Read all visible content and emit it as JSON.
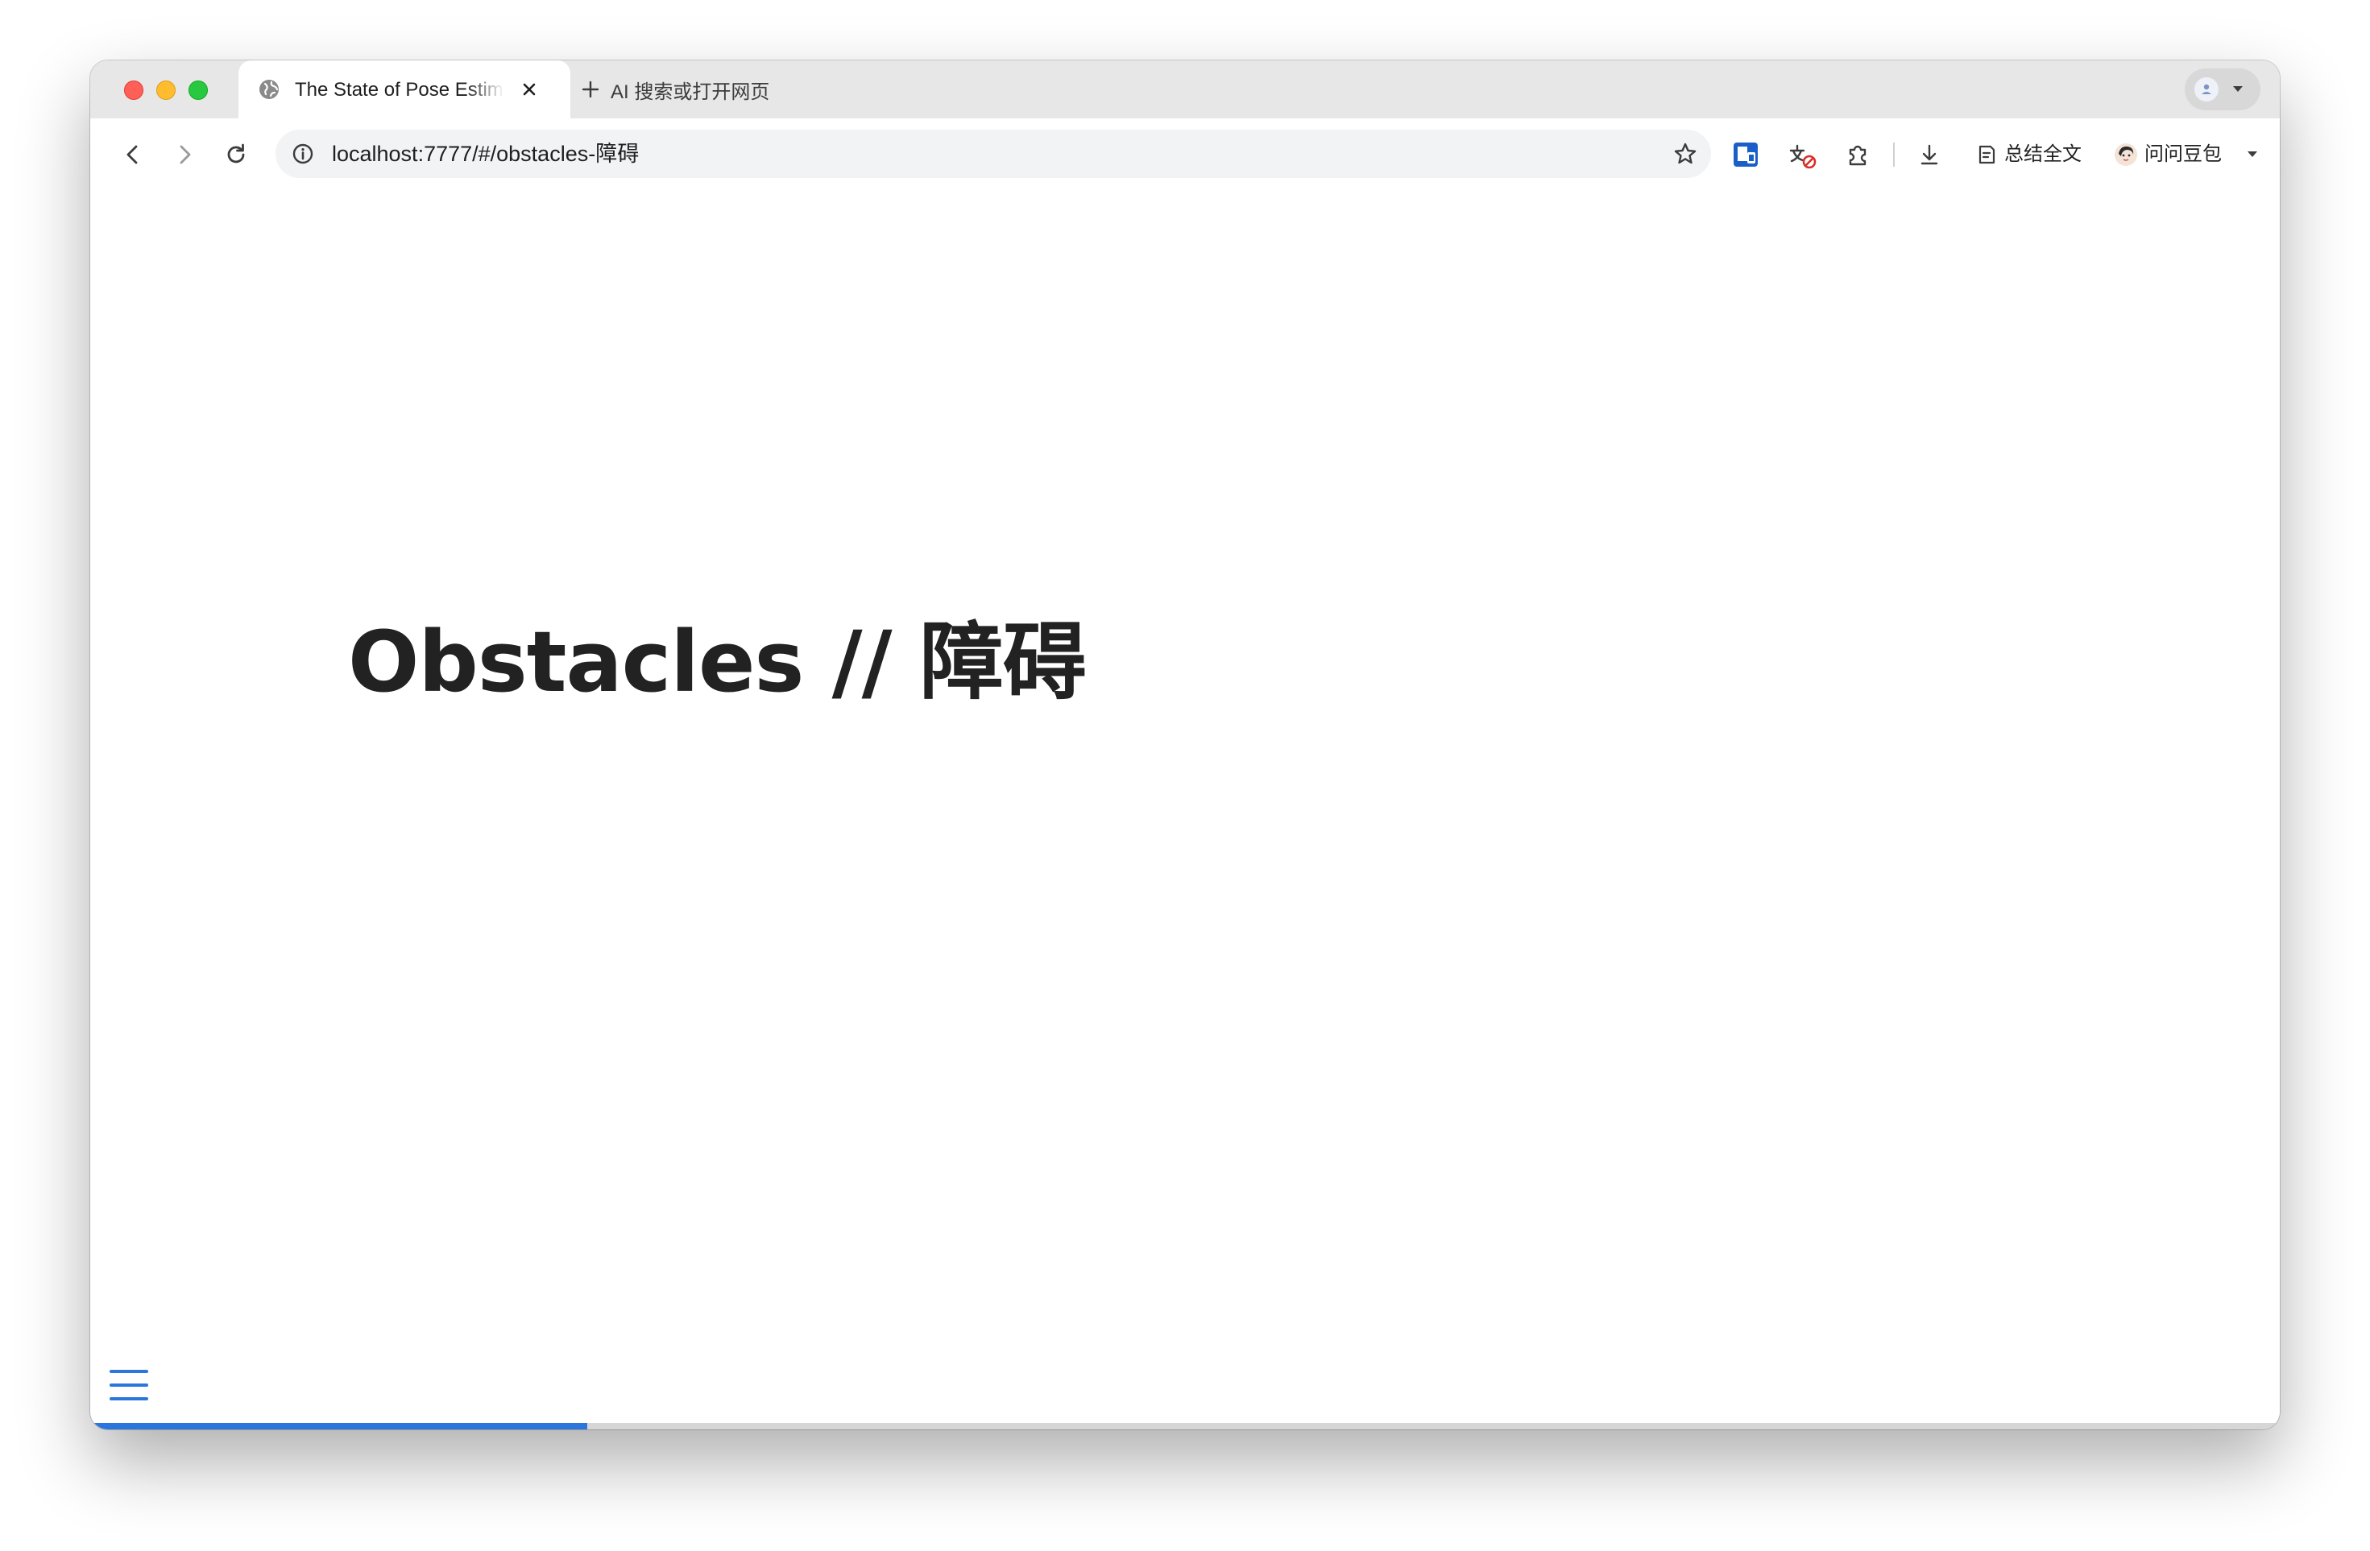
{
  "tab": {
    "title": "The State of Pose Estimation",
    "new_tab_label": "AI 搜索或打开网页"
  },
  "toolbar": {
    "url": "localhost:7777/#/obstacles-障碍",
    "summarize_label": "总结全文",
    "ask_label": "问问豆包"
  },
  "slide": {
    "title": "Obstacles // 障碍",
    "progress": 0.227
  },
  "colors": {
    "accent": "#2a76dd",
    "title_text": "#222222",
    "tabstrip_bg": "#e7e7e7"
  },
  "icons": [
    "globe-icon",
    "close-icon",
    "plus-icon",
    "profile-icon",
    "back-icon",
    "forward-icon",
    "reload-icon",
    "info-icon",
    "star-icon",
    "extension-shield-icon",
    "translate-icon",
    "puzzle-icon",
    "download-icon",
    "summary-icon",
    "doubao-avatar-icon",
    "chevron-down-icon",
    "menu-icon"
  ]
}
